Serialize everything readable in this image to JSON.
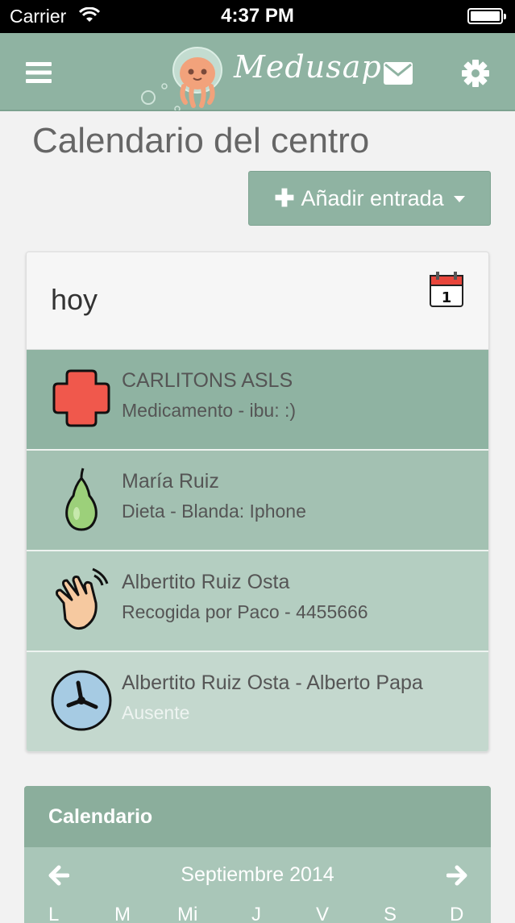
{
  "status_bar": {
    "carrier": "Carrier",
    "time": "4:37 PM"
  },
  "navbar": {
    "app_name": "Medusap",
    "icons": [
      "menu-icon",
      "envelope-icon",
      "gear-icon"
    ]
  },
  "page": {
    "title": "Calendario del centro",
    "add_button": "Añadir entrada"
  },
  "today": {
    "label": "hoy",
    "entries": [
      {
        "icon": "medicine-cross-icon",
        "title": "CARLITONS ASLS",
        "subtitle": "Medicamento - ibu: :)",
        "bg": "#8fb3a2"
      },
      {
        "icon": "pear-icon",
        "title": "María Ruiz",
        "subtitle": "Dieta - Blanda: Iphone",
        "bg": "#a3c1b2"
      },
      {
        "icon": "waving-hand-icon",
        "title": "Albertito Ruiz Osta",
        "subtitle": "Recogida por Paco - 4455666",
        "bg": "#b4cec1"
      },
      {
        "icon": "clock-icon",
        "title": "Albertito Ruiz Osta - Alberto Papa",
        "subtitle": "Ausente",
        "bg": "#c4d8ce"
      }
    ]
  },
  "calendar": {
    "title": "Calendario",
    "month": "Septiembre 2014",
    "weekdays": [
      "L",
      "M",
      "Mi",
      "J",
      "V",
      "S",
      "D"
    ]
  },
  "colors": {
    "accent": "#8fb3a2",
    "header": "#8bae9c"
  }
}
